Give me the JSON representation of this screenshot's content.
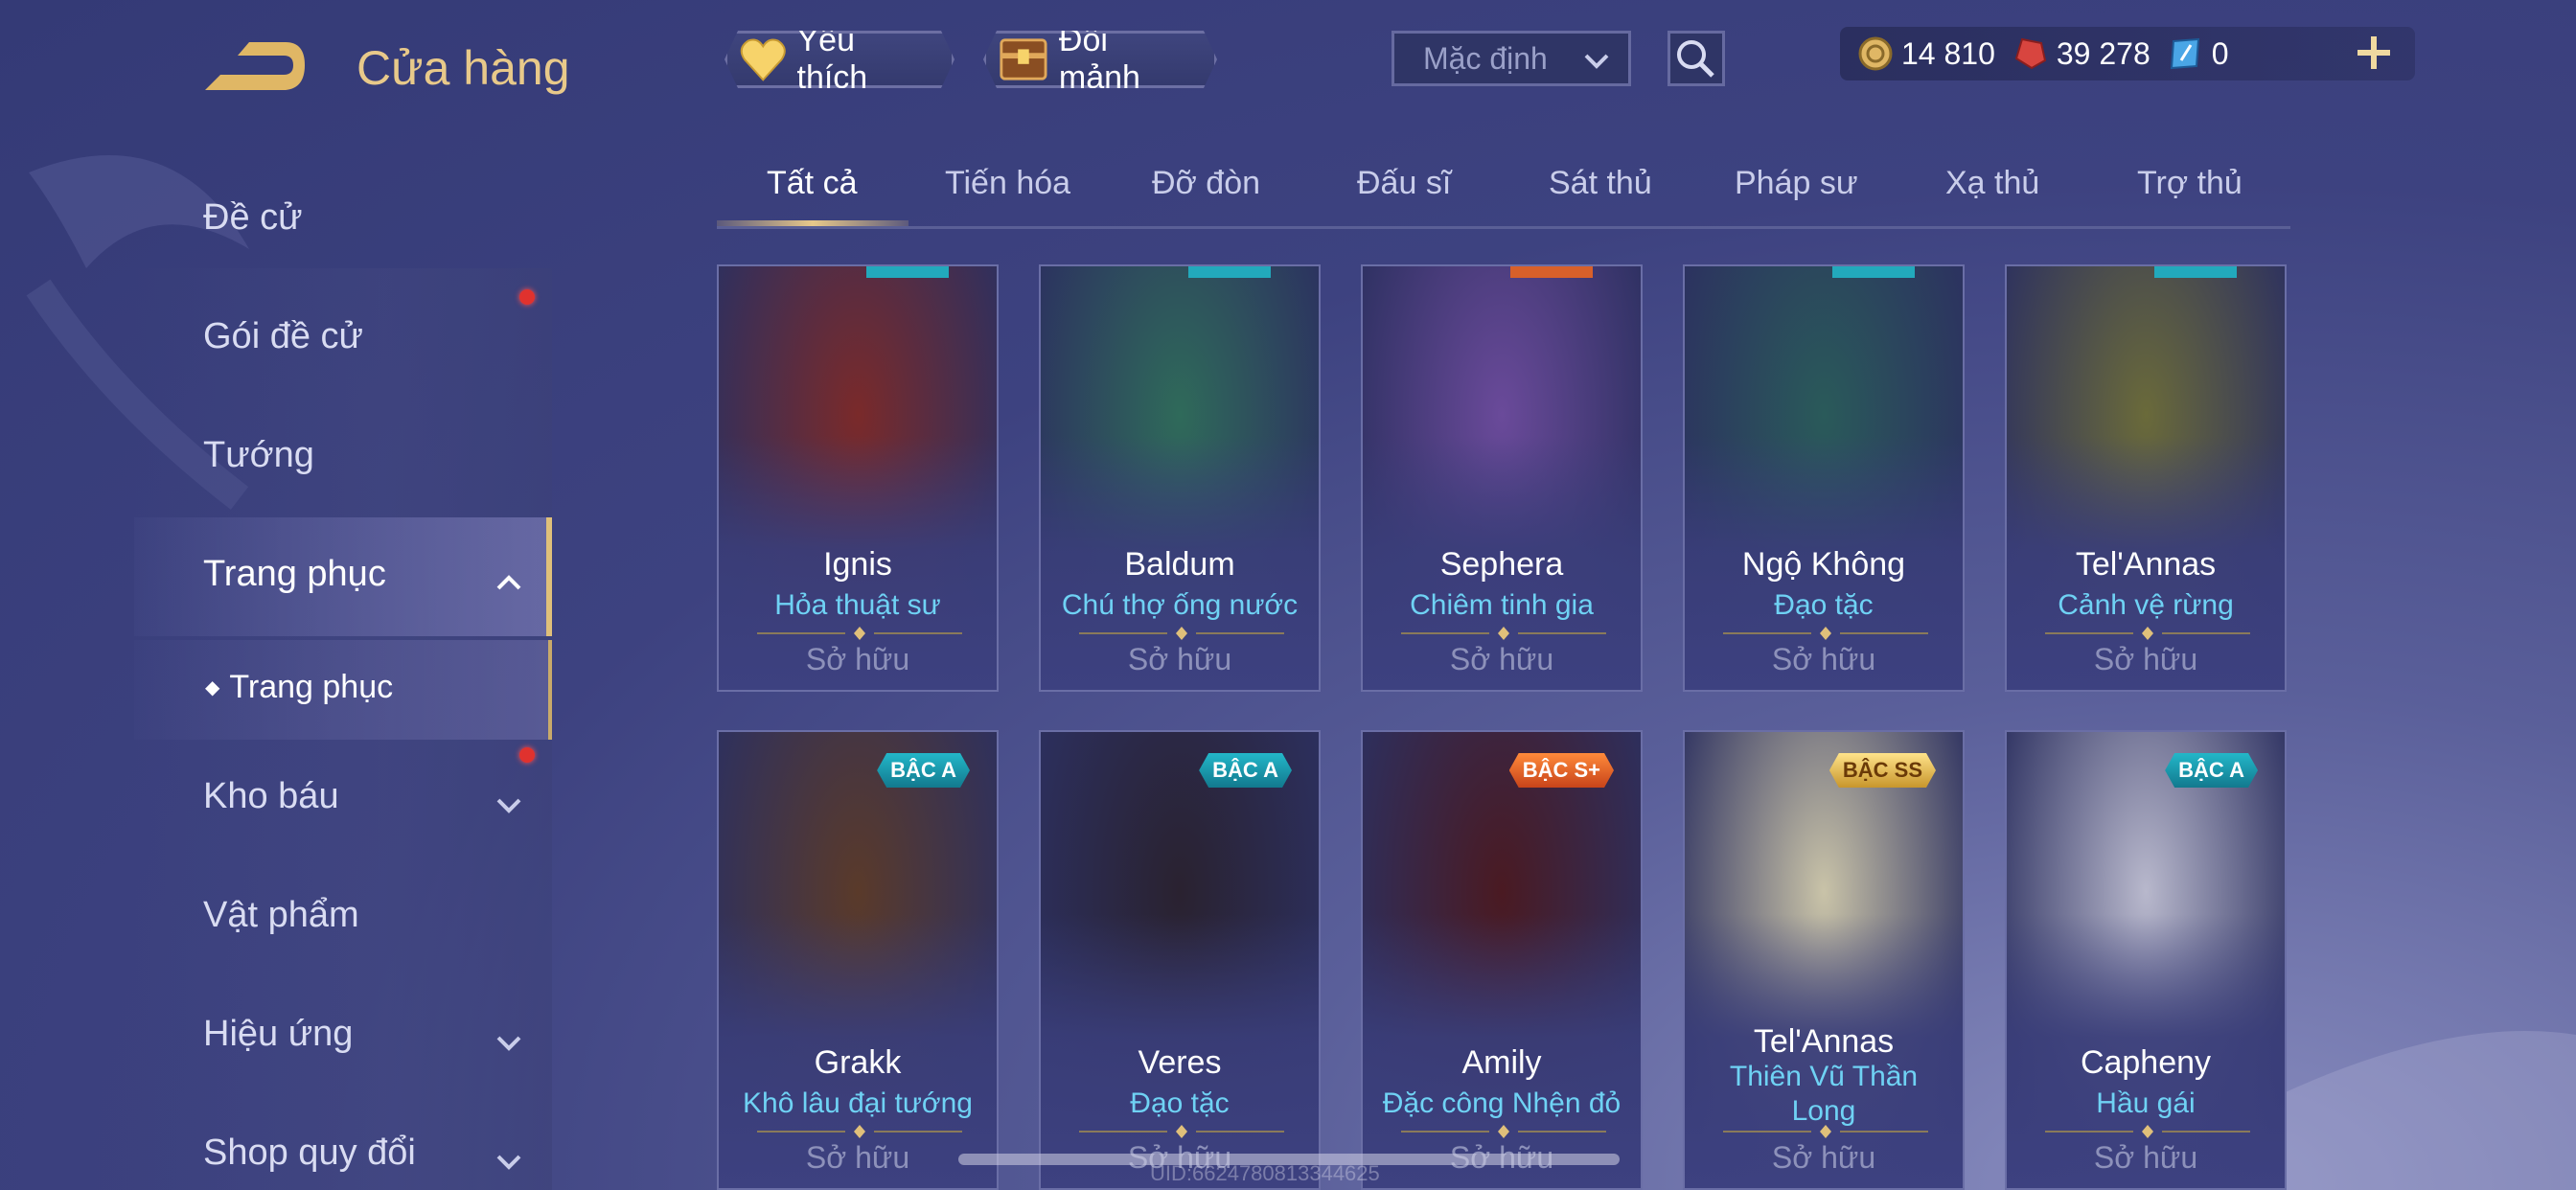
{
  "header": {
    "title": "Cửa hàng",
    "favorite_label": "Yêu thích",
    "fragment_label": "Đổi mảnh",
    "sort_selected": "Mặc định"
  },
  "currency": {
    "gold": "14 810",
    "vouchers": "39 278",
    "gems": "0"
  },
  "sidebar": {
    "items": [
      {
        "label": "Đề cử"
      },
      {
        "label": "Gói đề cử"
      },
      {
        "label": "Tướng"
      },
      {
        "label": "Trang phục"
      },
      {
        "label": "Kho báu"
      },
      {
        "label": "Vật phẩm"
      },
      {
        "label": "Hiệu ứng"
      },
      {
        "label": "Shop quy đổi"
      }
    ],
    "sub_item": "Trang phục"
  },
  "tabs": [
    "Tất cả",
    "Tiến hóa",
    "Đỡ đòn",
    "Đấu sĩ",
    "Sát thủ",
    "Pháp sư",
    "Xạ thủ",
    "Trợ thủ"
  ],
  "cards": [
    {
      "hero": "Ignis",
      "skin": "Hỏa thuật sư",
      "status": "Sở hữu",
      "art": "#7a2a2a"
    },
    {
      "hero": "Baldum",
      "skin": "Chú thợ ống nước",
      "status": "Sở hữu",
      "art": "#2f6a5a"
    },
    {
      "hero": "Sephera",
      "skin": "Chiêm tinh gia",
      "status": "Sở hữu",
      "art": "#6a4a9a"
    },
    {
      "hero": "Ngộ Không",
      "skin": "Đạo tặc",
      "status": "Sở hữu",
      "art": "#2a5a5a"
    },
    {
      "hero": "Tel'Annas",
      "skin": "Cảnh vệ rừng",
      "status": "Sở hữu",
      "art": "#6a6a3a"
    },
    {
      "hero": "Grakk",
      "skin": "Khô lâu đại tướng",
      "status": "Sở hữu",
      "badge": "BẬC A",
      "art": "#5a3a2a"
    },
    {
      "hero": "Veres",
      "skin": "Đạo tặc",
      "status": "Sở hữu",
      "badge": "BẬC A",
      "art": "#2a2230"
    },
    {
      "hero": "Amily",
      "skin": "Đặc công Nhện đỏ",
      "status": "Sở hữu",
      "badge": "BẬC S+",
      "art": "#4a1a22"
    },
    {
      "hero": "Tel'Annas",
      "skin": "Thiên Vũ Thần Long",
      "status": "Sở hữu",
      "badge": "BẬC SS",
      "art": "#c9c3a8"
    },
    {
      "hero": "Capheny",
      "skin": "Hầu gái",
      "status": "Sở hữu",
      "badge": "BẬC A",
      "art": "#b8b8cc"
    }
  ],
  "footer": {
    "uid": "UID:6624780813344625"
  }
}
